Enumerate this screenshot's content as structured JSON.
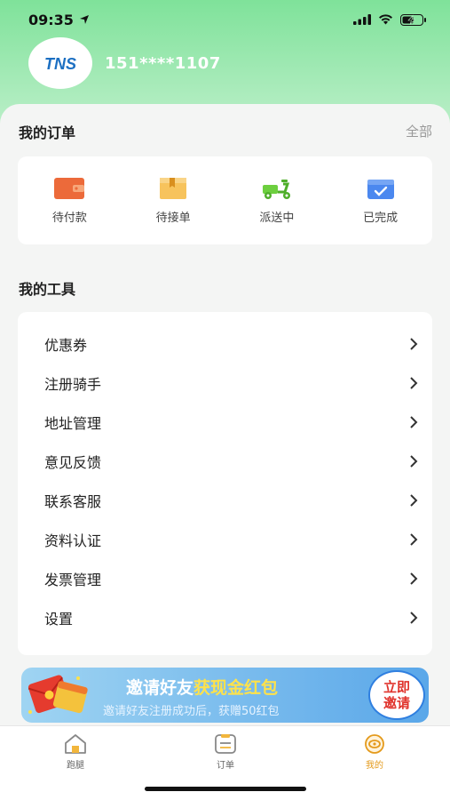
{
  "status_bar": {
    "time": "09:35"
  },
  "profile": {
    "avatar_text": "TNS",
    "phone": "151****1107"
  },
  "orders": {
    "title": "我的订单",
    "all_link": "全部",
    "items": [
      {
        "label": "待付款",
        "icon": "wallet-icon"
      },
      {
        "label": "待接单",
        "icon": "box-icon"
      },
      {
        "label": "派送中",
        "icon": "scooter-icon"
      },
      {
        "label": "已完成",
        "icon": "completed-box-icon"
      }
    ]
  },
  "tools": {
    "title": "我的工具",
    "items": [
      {
        "label": "优惠券"
      },
      {
        "label": "注册骑手"
      },
      {
        "label": "地址管理"
      },
      {
        "label": "意见反馈"
      },
      {
        "label": "联系客服"
      },
      {
        "label": "资料认证"
      },
      {
        "label": "发票管理"
      },
      {
        "label": "设置"
      }
    ]
  },
  "banner": {
    "title_part1": "邀请好友",
    "title_part2": "获现金红包",
    "subtitle": "邀请好友注册成功后，获赠50红包",
    "button_line1": "立即",
    "button_line2": "邀请"
  },
  "tab_bar": {
    "tabs": [
      {
        "label": "跑腿",
        "icon": "home-icon"
      },
      {
        "label": "订单",
        "icon": "order-list-icon"
      },
      {
        "label": "我的",
        "icon": "profile-icon",
        "active": true
      }
    ]
  },
  "colors": {
    "accent_green": "#7fe29a",
    "active_tab": "#e49a1c",
    "banner_blue": "#5aa7e9",
    "highlight_yellow": "#ffe24a"
  }
}
